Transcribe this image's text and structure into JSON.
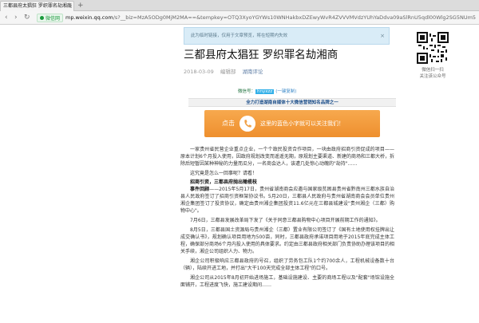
{
  "browser": {
    "tab_title": "三都县府太猖狂 罗织罪名劫湘商",
    "tab_close": "×",
    "tab_new": "+",
    "secure_label": "微信网",
    "url_host": "mp.weixin.qq.com",
    "url_rest": "/s?__biz=MzA5ODg0MjM2MA==&tempkey=OTQ3XyoYGYWs10WNHakbxDZEwyWvR4ZVVVMVdzYUhYaDdva09aSlRnU5qdl00Wlg2SG5NUm5"
  },
  "icons": {
    "back": "back-arrow-icon",
    "forward": "forward-arrow-icon",
    "reload": "reload-icon",
    "close": "close-icon",
    "phone": "phone-icon",
    "qr": "qr-code-icon"
  },
  "colors": {
    "accent_orange": "#f0a046",
    "notice_blue": "#d9ecf7",
    "title_text": "#111111",
    "link_blue": "#607fa6"
  },
  "notice": {
    "text": "此为临时链接，仅用于文章预览，将在短期内失效"
  },
  "article": {
    "title": "三都县府太猖狂 罗织罪名劫湘商",
    "date": "2018-03-09",
    "source": "编辑部",
    "account": "湖南评论",
    "wx_prefix": "微信号：",
    "wx_id": "hnyxzz",
    "wx_tip": "(一键复制)",
    "bar_text": "全力打造湖南自媒体十大微信营销知名品牌之一",
    "banner_left": "点击",
    "banner_right": "这里的蓝色小字就可以关注我们！",
    "paragraphs": [
      "一家贵州省民营企业重点企业，一个个政民投资合作项目，一块由政府招商引资促成的项目——原本计划6个月投入使用，因政府规划改变而遥遥无期，原规划主要渠道、新建的商场和三都大桥，拆除后短暂因某种神秘的力量而瓜分，一名商会达人，该遭几处惊心动魄的\"劫持\"……",
      "这究竟是怎么一回事呢？请看！"
    ],
    "subheading": "招商引资，三都县府抛出橄榄枝",
    "paragraphs2": [
      {
        "lead": "事件回顾",
        "text": "——2015年5月17日，贵州省湖南商会应邀与国家级贫困县贵州省黔南州三都水族自治县人民政府签订了招商引资框架协议书。5月20日，三都县人民政府与贵州省湖南商会会员单位贵州湘企集团签订了投资协议，确定由贵州湘企集团投资11.6亿元在三都县城建设\"贵州湘企（三都）购物中心\"。"
      },
      {
        "lead": "",
        "text": "7月6日，三都县发展改革局下发了《关于同意三都县购物中心项目开展前期工作的通知》。"
      },
      {
        "lead": "",
        "text": "8月5日，三都县国土资源局与贵州湘企（三都）置业有限公司签订了《国有土地使用权挂牌出让成交确认书》，规划确认项目用地为500亩，同时，三都县政府承诺项目用地于2015年底完成主体工程，确保部分商场6个月内投入使用的具体要求。约定由三都县政府相关部门负责协助办理该项目的相关手续，湘企公司组织人力、物力。"
      },
      {
        "lead": "",
        "text": "湘企公司积极响应三都县政府的号召，组织了劳务包工队1个约700余人，工程机械设备数十台（辆），陆续开进工地，并打出\"大干100天完成全部主体工程\"的口号。"
      },
      {
        "lead": "",
        "text": "湘企公司从2015年8月初开始进场施工，基础设施建设、主要的商场工程以及\"配套\"场馆设施全面铺开，工程进度飞快，施工建设期间……"
      }
    ]
  },
  "sidebar": {
    "qr_caption_1": "微信扫一扫",
    "qr_caption_2": "关注该公众号"
  }
}
